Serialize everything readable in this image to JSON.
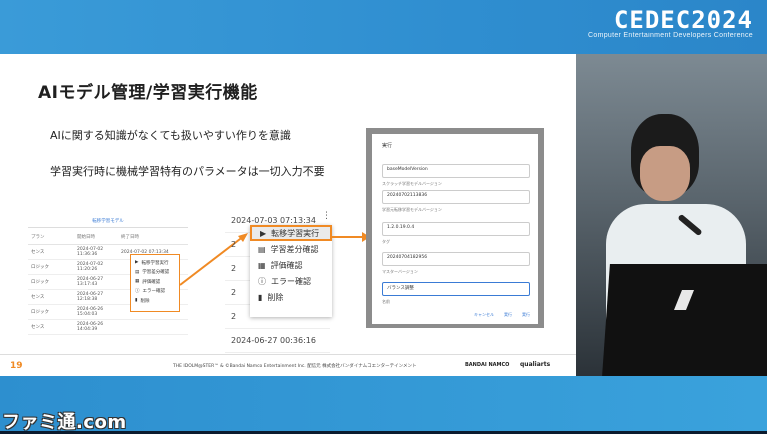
{
  "conference": {
    "logo": "CEDEC2024",
    "subtitle": "Computer Entertainment Developers Conference"
  },
  "slide": {
    "title": "AIモデル管理/学習実行機能",
    "bullets": [
      "AIに関する知識がなくても扱いやすい作りを意識",
      "学習実行時に機械学習特有のパラメータは一切入力不要"
    ],
    "table": {
      "header": "転移学習モデル",
      "columns": [
        "プラン",
        "開始日時",
        "終了日時"
      ],
      "rows": [
        [
          "センス",
          "2024-07-02 11:36:36",
          "2024-07-02 07:13:34"
        ],
        [
          "ロジック",
          "2024-07-02 11:20:26",
          ""
        ],
        [
          "ロジック",
          "2024-06-27 13:17:43",
          ""
        ],
        [
          "センス",
          "2024-06-27 12:18:38",
          ""
        ],
        [
          "ロジック",
          "2024-06-26 15:04:03",
          ""
        ],
        [
          "センス",
          "2024-06-26 14:04:39",
          ""
        ]
      ]
    },
    "mini_menu": [
      "転移学習実行",
      "学習差分確認",
      "評価確認",
      "エラー確認",
      "削除"
    ],
    "list_timestamps": [
      "2024-07-03 07:13:34",
      "2",
      "2",
      "2",
      "2",
      "2024-06-27 00:36:16"
    ],
    "menu": [
      {
        "label": "転移学習実行",
        "icon": "play-icon",
        "selected": true
      },
      {
        "label": "学習差分確認",
        "icon": "compare-icon",
        "selected": false
      },
      {
        "label": "評価確認",
        "icon": "chart-icon",
        "selected": false
      },
      {
        "label": "エラー確認",
        "icon": "error-icon",
        "selected": false
      },
      {
        "label": "削除",
        "icon": "trash-icon",
        "selected": false
      }
    ],
    "dialog": {
      "title": "実行",
      "fields": [
        {
          "value": "baseModelVersion",
          "hint": "スクラッチ学習モデルバージョン"
        },
        {
          "value": "20240702113836",
          "hint": "学習元転移学習モデルバージョン"
        },
        {
          "value": "1.2.0.19.0.4",
          "hint": "タグ"
        },
        {
          "value": "20240704182956",
          "hint": "マスターバージョン"
        },
        {
          "value": "バランス調整",
          "hint": "名前"
        }
      ],
      "actions": [
        "キャンセル",
        "実行",
        "実行"
      ]
    },
    "page_number": "19",
    "copyright": "THE IDOLM@STER™ & ©Bandai Namco Entertainment Inc. 配信元 株式会社バンダイナムコエンターテインメント",
    "brand1": "BANDAI NAMCO",
    "brand2": "qualiarts"
  },
  "watermark": "ファミ通.com",
  "colors": {
    "accent": "#f08a24",
    "banner": "#2f8ed0",
    "link": "#3a7bd5"
  }
}
